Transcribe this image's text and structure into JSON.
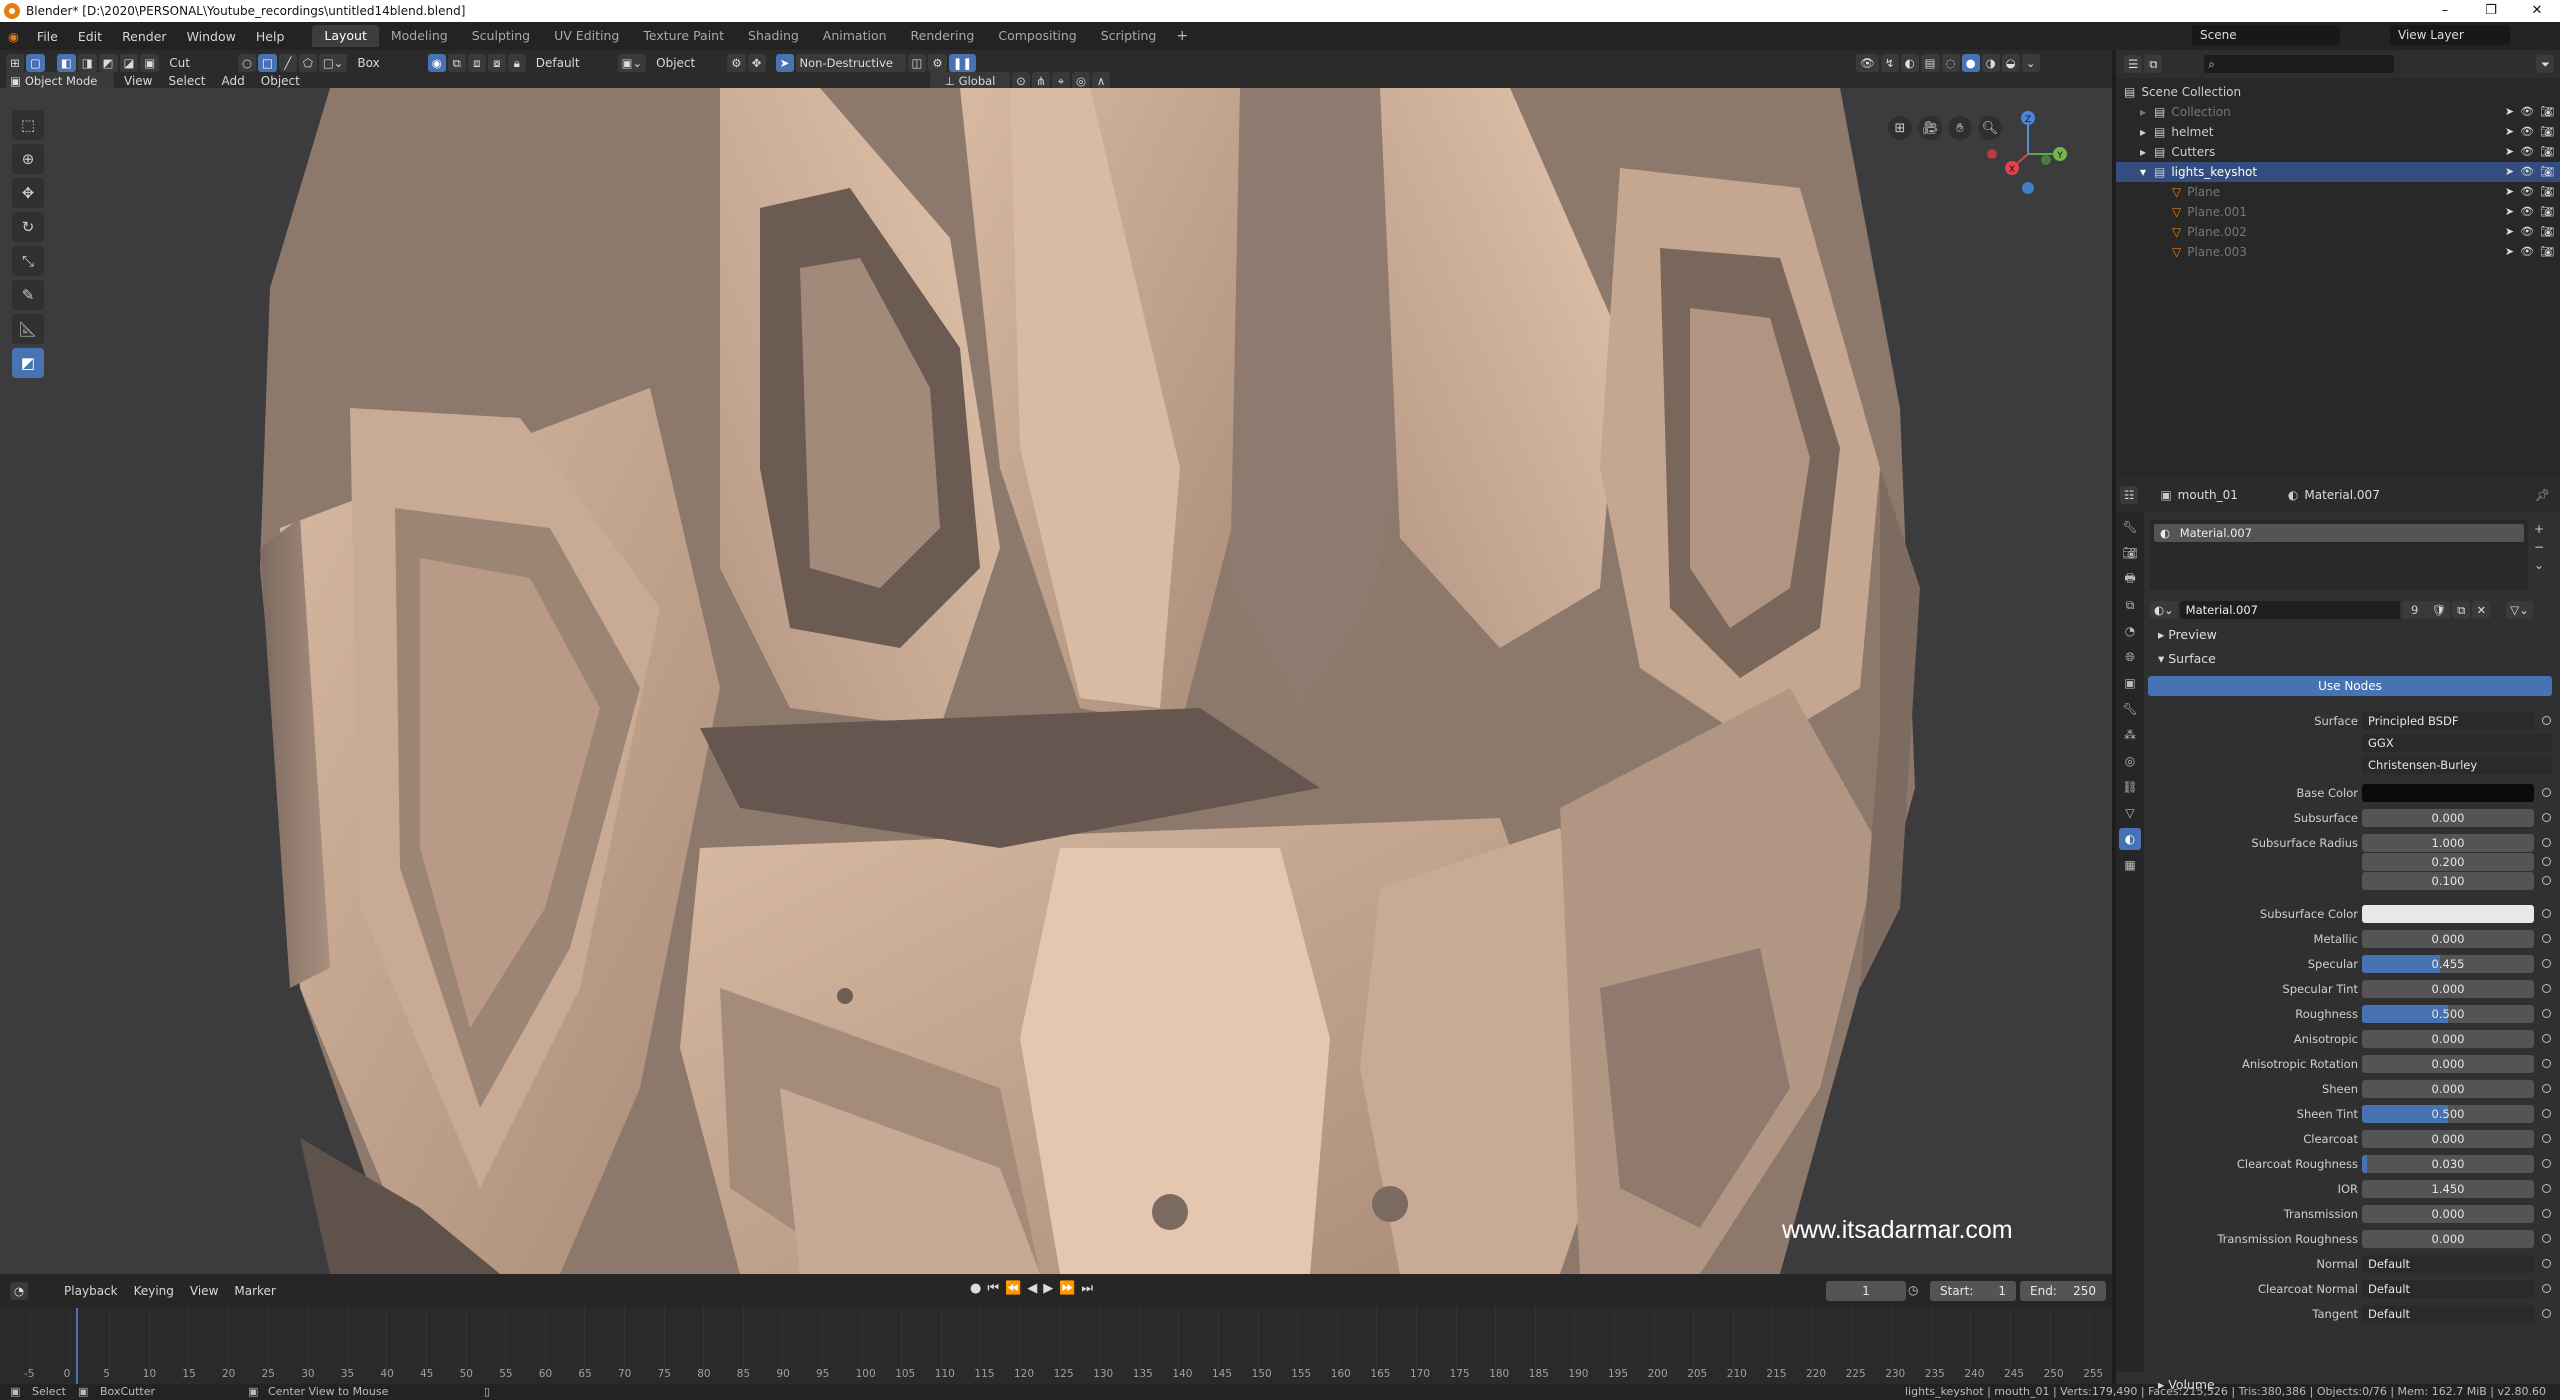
{
  "window": {
    "title": "Blender* [D:\\2020\\PERSONAL\\Youtube_recordings\\untitled14blend.blend]",
    "minimize": "–",
    "maximize": "❐",
    "close": "✕"
  },
  "menu": [
    "File",
    "Edit",
    "Render",
    "Window",
    "Help"
  ],
  "workspaces": [
    "Layout",
    "Modeling",
    "Sculpting",
    "UV Editing",
    "Texture Paint",
    "Shading",
    "Animation",
    "Rendering",
    "Compositing",
    "Scripting"
  ],
  "workspace_add": "+",
  "scene": {
    "name": "Scene",
    "view_layer": "View Layer"
  },
  "viewport_header": {
    "cut_label": "Cut",
    "shape_label": "Box",
    "default_label": "Default",
    "object_label": "Object",
    "mode_label": "Non-Destructive",
    "mode": "Object Mode",
    "menu": [
      "View",
      "Select",
      "Add",
      "Object"
    ],
    "orientation": "Global"
  },
  "watermark": "www.itsadarmar.com",
  "gizmo": {
    "x": "X",
    "y": "Y",
    "z": "Z"
  },
  "timeline": {
    "menus": [
      "Playback",
      "Keying",
      "View",
      "Marker"
    ],
    "current_frame": "1",
    "start_label": "Start:",
    "start": "1",
    "end_label": "End:",
    "end": "250",
    "ticks": [
      "-5",
      "0",
      "5",
      "10",
      "15",
      "20",
      "25",
      "30",
      "35",
      "40",
      "45",
      "50",
      "55",
      "60",
      "65",
      "70",
      "75",
      "80",
      "85",
      "90",
      "95",
      "100",
      "105",
      "110",
      "115",
      "120",
      "125",
      "130",
      "135",
      "140",
      "145",
      "150",
      "155",
      "160",
      "165",
      "170",
      "175",
      "180",
      "185",
      "190",
      "195",
      "200",
      "205",
      "210",
      "215",
      "220",
      "225",
      "230",
      "235",
      "240",
      "245",
      "250",
      "255"
    ]
  },
  "statusbar": {
    "select": "Select",
    "boxcutter": "BoxCutter",
    "center": "Center View to Mouse",
    "stats": "lights_keyshot | mouth_01 | Verts:179,490 | Faces:215,526 | Tris:380,386 | Objects:0/76 | Mem: 162.7 MiB | v2.80.60"
  },
  "outliner": {
    "root": "Scene Collection",
    "items": [
      {
        "label": "Collection",
        "dim": true,
        "indent": 1
      },
      {
        "label": "helmet",
        "dim": false,
        "indent": 1
      },
      {
        "label": "Cutters",
        "dim": false,
        "indent": 1
      },
      {
        "label": "lights_keyshot",
        "dim": false,
        "indent": 1,
        "selected": true
      },
      {
        "label": "Plane",
        "dim": true,
        "indent": 2
      },
      {
        "label": "Plane.001",
        "dim": true,
        "indent": 2
      },
      {
        "label": "Plane.002",
        "dim": true,
        "indent": 2
      },
      {
        "label": "Plane.003",
        "dim": true,
        "indent": 2
      }
    ]
  },
  "properties": {
    "object": "mouth_01",
    "material": "Material.007",
    "slot": "Material.007",
    "datablock": "Material.007",
    "users": "9",
    "preview": "Preview",
    "surface_section": "Surface",
    "use_nodes": "Use Nodes",
    "surface_label": "Surface",
    "surface_value": "Principled BSDF",
    "distribution": "GGX",
    "subsurface_method": "Christensen-Burley",
    "rows": [
      {
        "label": "Base Color",
        "value": "",
        "color": "#0a0a0a"
      },
      {
        "label": "Subsurface",
        "value": "0.000"
      },
      {
        "label": "Subsurface Radius",
        "value": "1.000"
      },
      {
        "label": "",
        "value": "0.200"
      },
      {
        "label": "",
        "value": "0.100"
      },
      {
        "label": "Subsurface Color",
        "value": "",
        "color": "#e8e8e8"
      },
      {
        "label": "Metallic",
        "value": "0.000"
      },
      {
        "label": "Specular",
        "value": "0.455",
        "fill": 0.455
      },
      {
        "label": "Specular Tint",
        "value": "0.000"
      },
      {
        "label": "Roughness",
        "value": "0.500",
        "fill": 0.5
      },
      {
        "label": "Anisotropic",
        "value": "0.000"
      },
      {
        "label": "Anisotropic Rotation",
        "value": "0.000"
      },
      {
        "label": "Sheen",
        "value": "0.000"
      },
      {
        "label": "Sheen Tint",
        "value": "0.500",
        "fill": 0.5
      },
      {
        "label": "Clearcoat",
        "value": "0.000"
      },
      {
        "label": "Clearcoat Roughness",
        "value": "0.030",
        "fill": 0.03
      },
      {
        "label": "IOR",
        "value": "1.450"
      },
      {
        "label": "Transmission",
        "value": "0.000"
      },
      {
        "label": "Transmission Roughness",
        "value": "0.000"
      },
      {
        "label": "Normal",
        "value": "Default",
        "text": true
      },
      {
        "label": "Clearcoat Normal",
        "value": "Default",
        "text": true
      },
      {
        "label": "Tangent",
        "value": "Default",
        "text": true
      }
    ],
    "volume": "Volume"
  },
  "colors": {
    "accent": "#4772b3",
    "selected": "#334d80",
    "orange": "#e87d0d",
    "model": "#c8a993"
  }
}
